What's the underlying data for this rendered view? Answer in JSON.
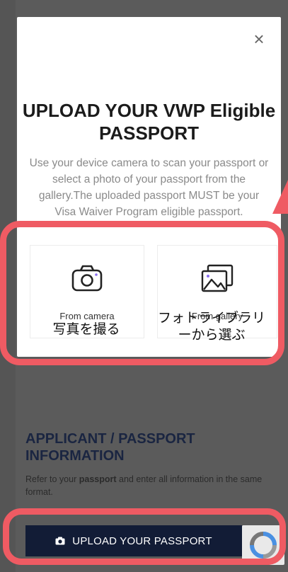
{
  "modal": {
    "close_label": "×",
    "title_line1": "UPLOAD YOUR VWP Eligible",
    "title_line2": "PASSPORT",
    "description": "Use your device camera to scan your passport or select a photo of your passport from the gallery.The uploaded passport MUST be your Visa Waiver Program eligible passport.",
    "options": [
      {
        "label": "From camera",
        "icon": "camera-icon"
      },
      {
        "label": "From gallery",
        "icon": "gallery-icon"
      }
    ]
  },
  "annotations": {
    "camera_jp": "写真を撮る",
    "gallery_jp_line1": "フォトライブラリ",
    "gallery_jp_line2": "ーから選ぶ",
    "highlight_color": "#ef5b63"
  },
  "page": {
    "section_title_line1": "APPLICANT / PASSPORT",
    "section_title_line2": "INFORMATION",
    "subtitle_prefix": "Refer to your ",
    "subtitle_bold": "passport",
    "subtitle_suffix": " and enter all information in the same format.",
    "upload_button_label": "UPLOAD YOUR PASSPORT",
    "upload_button_icon": "camera-icon",
    "recaptcha_icon": "recaptcha-icon"
  },
  "colors": {
    "overlay": "#5b5b5b",
    "button_bg": "#121c36",
    "title_color": "#1a2541"
  }
}
